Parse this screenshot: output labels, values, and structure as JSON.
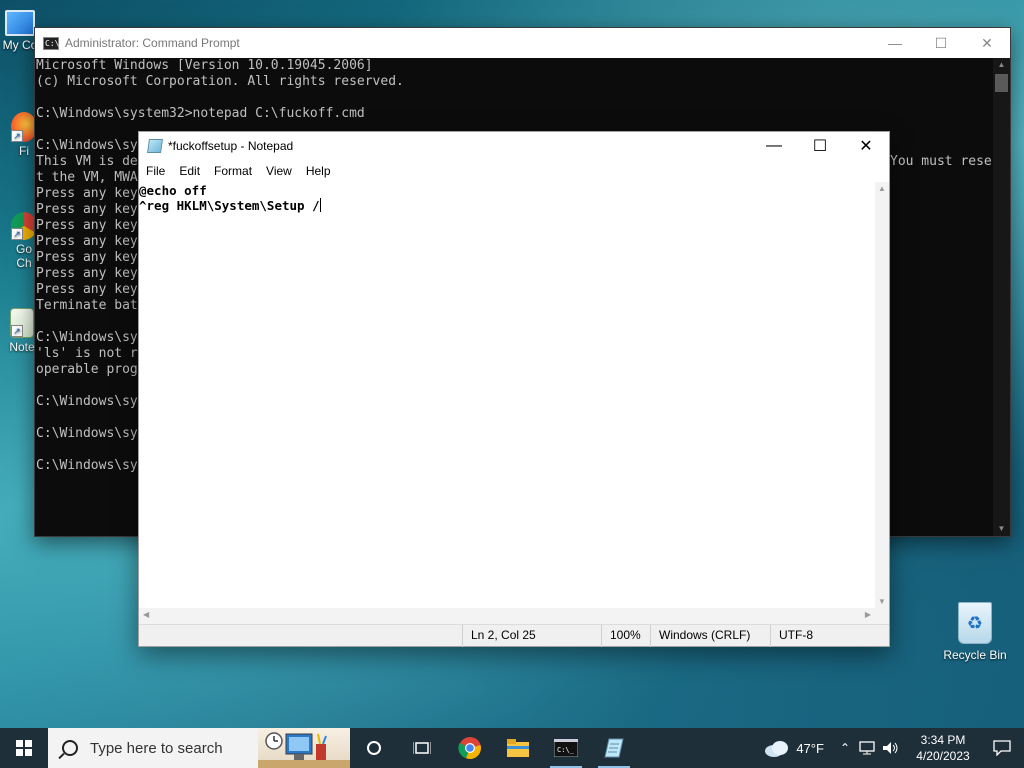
{
  "desktop": {
    "icons": [
      {
        "label": "My Co",
        "name": "my-computer"
      },
      {
        "label": "Fi",
        "name": "firefox"
      },
      {
        "label": "Go Ch",
        "name": "google-chrome"
      },
      {
        "label": "Note",
        "name": "notepad"
      }
    ],
    "recycle_bin": "Recycle Bin"
  },
  "cmd": {
    "title": "Administrator: Command Prompt",
    "lines": [
      "Microsoft Windows [Version 10.0.19045.2006]",
      "(c) Microsoft Corporation. All rights reserved.",
      "",
      "C:\\Windows\\system32>notepad C:\\fuckoff.cmd",
      "",
      "C:\\Windows\\sy",
      "This VM is de",
      "t the VM, MWA",
      "Press any key",
      "Press any key",
      "Press any key",
      "Press any key",
      "Press any key",
      "Press any key",
      "Press any key",
      "Terminate bat",
      "",
      "C:\\Windows\\sy",
      "'ls' is not r",
      "operable prog",
      "",
      "C:\\Windows\\sy",
      "",
      "C:\\Windows\\sy",
      "",
      "C:\\Windows\\sy"
    ],
    "right_text": "You must rese"
  },
  "notepad": {
    "title": "*fuckoffsetup - Notepad",
    "menu": [
      "File",
      "Edit",
      "Format",
      "View",
      "Help"
    ],
    "line1": "@echo off",
    "line2": "^reg HKLM\\System\\Setup /",
    "status": {
      "position": "Ln 2, Col 25",
      "zoom": "100%",
      "line_ending": "Windows (CRLF)",
      "encoding": "UTF-8"
    }
  },
  "taskbar": {
    "search_placeholder": "Type here to search",
    "weather": "47°F",
    "time": "3:34 PM",
    "date": "4/20/2023"
  }
}
